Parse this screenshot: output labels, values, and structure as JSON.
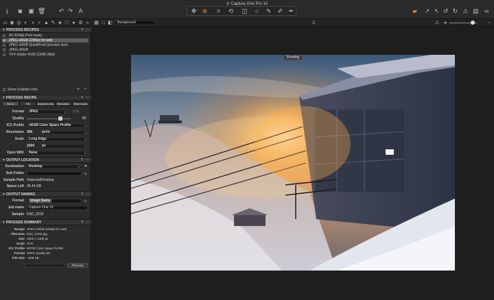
{
  "app": {
    "title": "Capture One Pro 10",
    "title_icon": "capture-one-logo-icon"
  },
  "colors": {
    "accent": "#e0803a",
    "selected_row": "#5f5f5f",
    "panel": "#2b2b2b",
    "viewer": "#1e1e1e"
  },
  "toolbar": {
    "left_icons": [
      "import-icon",
      "camera-icon",
      "folder-check-icon",
      "trash-icon",
      "undo-icon",
      "redo-icon",
      "text-cursor-icon"
    ],
    "center_icons": [
      "pan-icon",
      "loupe-icon",
      "crop-icon",
      "rotate-icon",
      "keystone-icon",
      "circle-mask-icon",
      "brush-icon",
      "picker-icon",
      "annotate-icon"
    ],
    "right_icons": [
      "cursor-tools-icon",
      "copy-apply-icon",
      "reset-icon",
      "rotate-left-icon",
      "rotate-right-icon",
      "warning-icon",
      "print-icon",
      "glasses-icon"
    ]
  },
  "subbar": {
    "background_select": "Background"
  },
  "process_recipes": {
    "header": "PROCESS RECIPES",
    "items": [
      {
        "label": "A3 300dpi Print ready",
        "checked": false,
        "selected": false
      },
      {
        "label": "JPEG sRGB 2200px for web",
        "checked": true,
        "selected": true
      },
      {
        "label": "JPEG sRGB QuickProof (preview size)",
        "checked": false,
        "selected": false
      },
      {
        "label": "JPEG sRGB",
        "checked": false,
        "selected": false
      },
      {
        "label": "TIFF Adobe RGB (1998) (8bit)",
        "checked": false,
        "selected": false
      }
    ],
    "show_enabled_only": "Show Enabled Only"
  },
  "process_recipe": {
    "header": "PROCESS RECIPE",
    "tabs": [
      "Basic",
      "File",
      "Adjustments",
      "Metadata",
      "Watermark"
    ],
    "format_label": "Format",
    "format_value": "JPEG",
    "format_extra": "8 bit",
    "quality_label": "Quality",
    "quality_value": "80",
    "quality_fraction": 0.8,
    "icc_label": "ICC Profile",
    "icc_value": "sRGB Color Space Profile",
    "resolution_label": "Resolution",
    "resolution_value": "300",
    "resolution_unit": "px/in",
    "scale_label": "Scale",
    "scale_value": "Long Edge",
    "size_value": "2200",
    "size_unit": "px",
    "open_with_label": "Open With",
    "open_with_value": "None"
  },
  "output_location": {
    "header": "OUTPUT LOCATION",
    "destination_label": "Destination",
    "destination_value": "Desktop",
    "sub_folder_label": "Sub Folder",
    "sub_folder_value": "",
    "sample_path_label": "Sample Path",
    "sample_path_value": "/Users/af/Desktop",
    "space_left_label": "Space Left",
    "space_left_value": "35.44 GB"
  },
  "output_naming": {
    "header": "OUTPUT NAMING",
    "format_label": "Format",
    "format_value": "Image Name",
    "job_name_label": "Job name",
    "job_name_value": "Capture One 10",
    "sample_label": "Sample",
    "sample_value": "DSC_0103"
  },
  "process_summary": {
    "header": "PROCESS SUMMARY",
    "rows": [
      {
        "label": "Recipe",
        "value": "JPEG sRGB 2200px for web"
      },
      {
        "label": "Filename",
        "value": "DSC_0103.jpg"
      },
      {
        "label": "Size",
        "value": "2200 x 1468 px"
      },
      {
        "label": "Scale",
        "value": "31%"
      },
      {
        "label": "ICC Profile",
        "value": "sRGB Color Space Profile"
      },
      {
        "label": "Format",
        "value": "JPEG Quality 80"
      },
      {
        "label": "File Size",
        "value": "~638 KB"
      }
    ],
    "process_button": "Process"
  },
  "viewer": {
    "proofing_label": "Proofing"
  }
}
